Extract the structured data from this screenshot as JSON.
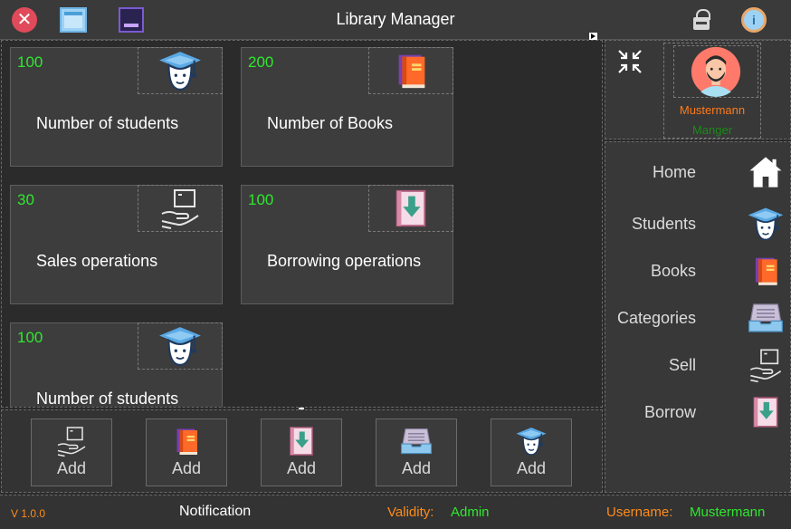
{
  "window": {
    "title": "Library Manager",
    "close_icon": "close-icon",
    "maximize_icon": "maximize-icon",
    "minimize_icon": "minimize-icon",
    "lock_icon": "lock-icon",
    "info_icon": "info-icon"
  },
  "cards": [
    {
      "value": "100",
      "label": "Number of students",
      "icon": "graduate-icon"
    },
    {
      "value": "200",
      "label": "Number of Books",
      "icon": "book-icon"
    },
    {
      "value": "30",
      "label": "Sales operations",
      "icon": "sell-hand-icon"
    },
    {
      "value": "100",
      "label": "Borrowing operations",
      "icon": "borrow-book-icon"
    },
    {
      "value": "100",
      "label": "Number of students",
      "icon": "graduate-icon"
    }
  ],
  "add_bar": {
    "buttons": [
      {
        "label": "Add",
        "icon": "sell-hand-icon"
      },
      {
        "label": "Add",
        "icon": "book-icon"
      },
      {
        "label": "Add",
        "icon": "borrow-book-icon"
      },
      {
        "label": "Add",
        "icon": "category-tray-icon"
      },
      {
        "label": "Add",
        "icon": "graduate-icon"
      }
    ]
  },
  "profile": {
    "name": "Mustermann",
    "role": "Manger",
    "shrink_icon": "shrink-icon",
    "avatar_icon": "avatar-icon"
  },
  "sidebar": {
    "items": [
      {
        "label": "Home",
        "icon": "home-icon"
      },
      {
        "label": "Students",
        "icon": "graduate-icon"
      },
      {
        "label": "Books",
        "icon": "book-icon"
      },
      {
        "label": "Categories",
        "icon": "category-tray-icon"
      },
      {
        "label": "Sell",
        "icon": "sell-hand-icon"
      },
      {
        "label": "Borrow",
        "icon": "borrow-book-icon"
      }
    ]
  },
  "status": {
    "version": "V 1.0.0",
    "notification": "Notification",
    "validity_label": "Validity:",
    "validity_value": "Admin",
    "username_label": "Username:",
    "username_value": "Mustermann"
  },
  "colors": {
    "background": "#2b2b2b",
    "card": "#3d3d3d",
    "value_green": "#2ee82e",
    "accent_orange": "#ff8c1a",
    "close_red": "#e04a5a"
  }
}
